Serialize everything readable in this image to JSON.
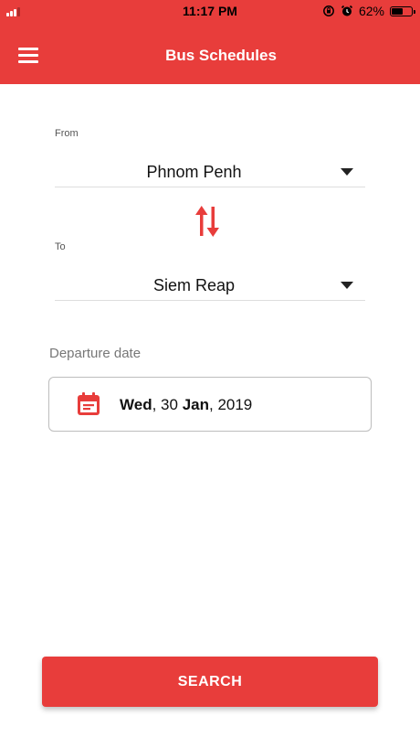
{
  "status_bar": {
    "time": "11:17 PM",
    "battery_percent": "62%",
    "battery_level": 0.62,
    "icons": [
      "cellular-signal-icon",
      "orientation-lock-icon",
      "alarm-icon",
      "battery-icon"
    ]
  },
  "header": {
    "title": "Bus Schedules",
    "menu_icon": "hamburger-menu-icon",
    "background": "#e83d3b"
  },
  "route": {
    "from_label": "From",
    "from_value": "Phnom Penh",
    "to_label": "To",
    "to_value": "Siem Reap",
    "swap_icon": "swap-vertical-icon",
    "dropdown_icon": "caret-down-icon"
  },
  "departure": {
    "label": "Departure date",
    "weekday": "Wed",
    "day": "30",
    "month": "Jan",
    "year": "2019",
    "icon": "calendar-icon"
  },
  "actions": {
    "search_label": "SEARCH"
  },
  "colors": {
    "accent": "#e83d3b"
  }
}
